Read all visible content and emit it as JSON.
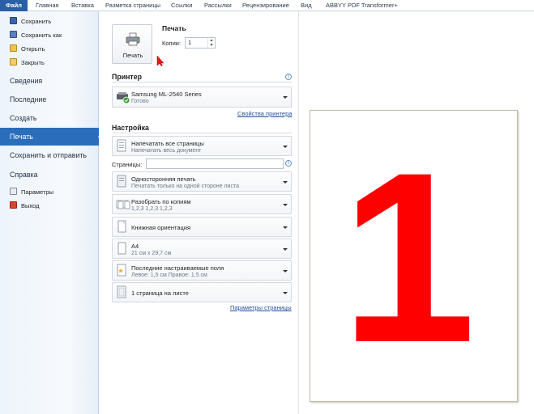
{
  "ribbon_tabs": [
    "Файл",
    "Главная",
    "Вставка",
    "Разметка страницы",
    "Ссылки",
    "Рассылки",
    "Рецензирование",
    "Вид",
    "ABBYY PDF Transformer+"
  ],
  "leftnav": {
    "save": "Сохранить",
    "save_as": "Сохранить как",
    "open": "Открыть",
    "close": "Закрыть",
    "info": "Сведения",
    "recent": "Последние",
    "new": "Создать",
    "print": "Печать",
    "save_send": "Сохранить и отправить",
    "help": "Справка",
    "options": "Параметры",
    "exit": "Выход"
  },
  "print": {
    "button_label": "Печать",
    "heading": "Печать",
    "copies_label": "Копии:",
    "copies_value": "1"
  },
  "printer": {
    "heading": "Принтер",
    "name": "Samsung ML-2540 Series",
    "status": "Готово",
    "properties_link": "Свойства принтера"
  },
  "settings": {
    "heading": "Настройка",
    "scope_title": "Напечатать все страницы",
    "scope_sub": "Напечатать весь документ",
    "pages_label": "Страницы:",
    "sides_title": "Односторонняя печать",
    "sides_sub": "Печатать только на одной стороне листа",
    "collate_title": "Разобрать по копиям",
    "collate_sub": "1,2,3    1,2,3    1,2,3",
    "orientation_title": "Книжная ориентация",
    "paper_title": "А4",
    "paper_sub": "21 см x 29,7 см",
    "margins_title": "Последние настраиваемые поля",
    "margins_sub": "Левое:  1,5 см    Правое:  1,5 см",
    "per_sheet_title": "1 страница на листе",
    "page_setup_link": "Параметры страницы"
  },
  "preview": {
    "page_number": "1",
    "number_color": "#ff0000"
  },
  "colors": {
    "accent": "#2a6ebb",
    "file_tab": "#2a5fa7"
  }
}
